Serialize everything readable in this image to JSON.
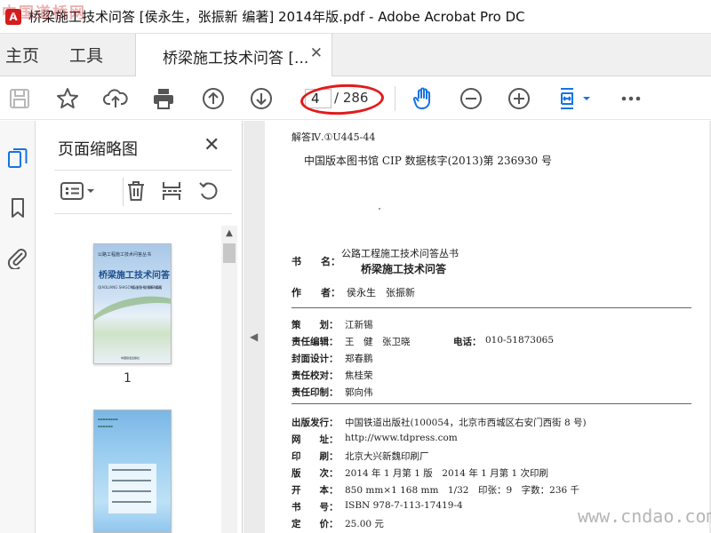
{
  "window": {
    "title": "桥梁施工技术问答 [侯永生，张振新 编著] 2014年版.pdf - Adobe Acrobat Pro DC",
    "watermark_top": "中国道桥网",
    "app_logo_glyph": "A"
  },
  "tabs": {
    "home": "主页",
    "tools": "工具",
    "document": "桥梁施工技术问答 [...",
    "close_glyph": "✕"
  },
  "toolbar": {
    "icons": [
      "save-icon",
      "bookmark-star-icon",
      "upload-cloud-icon",
      "print-icon",
      "previous-page-icon",
      "next-page-icon",
      "hand-tool-icon",
      "zoom-out-icon",
      "zoom-in-icon",
      "fit-page-icon",
      "more-icon"
    ],
    "current_page": "4",
    "total_pages": "/ 286",
    "accent": "#1473e6",
    "highlight_color": "#e21b1b"
  },
  "thumbnail_panel": {
    "title": "页面缩略图",
    "close_glyph": "✕",
    "thumbnails": [
      {
        "series": "公路工程施工技术问答丛书",
        "title": "桥梁施工技术问答",
        "pinyin": "QIAOLIANG SHIGONG JISHU WENDA",
        "authors": "侯永生 张振新 编著",
        "publisher": "中国铁道出版社",
        "label": "1"
      },
      {
        "label": ""
      }
    ]
  },
  "document": {
    "cip_line1": "解答Ⅳ.①U445-44",
    "cip_line2": "中国版本图书馆 CIP 数据核字(2013)第 236930 号",
    "book_label": "书　　名：",
    "book_series": "公路工程施工技术问答丛书",
    "book_title": "桥梁施工技术问答",
    "author_label": "作　　者：",
    "author_value": "侯永生　张振新",
    "credits": [
      {
        "label": "策　　划：",
        "value": "江新锡"
      },
      {
        "label": "责任编辑：",
        "value": "王　健　张卫晓"
      },
      {
        "label": "封面设计：",
        "value": "郑春鹏"
      },
      {
        "label": "责任校对：",
        "value": "焦桂荣"
      },
      {
        "label": "责任印制：",
        "value": "郭向伟"
      }
    ],
    "phone_label": "电话：",
    "phone_value": "010-51873065",
    "pub_info": [
      {
        "label": "出版发行：",
        "value": "中国铁道出版社(100054，北京市西城区右安门西街 8 号)"
      },
      {
        "label": "网　　址：",
        "value": "http://www.tdpress.com"
      },
      {
        "label": "印　　刷：",
        "value": "北京大兴新魏印刷厂"
      },
      {
        "label": "版　　次：",
        "value": "2014 年 1 月第 1 版　2014 年 1 月第 1 次印刷"
      },
      {
        "label": "开　　本：",
        "value": "850 mm×1 168 mm　1/32　印张：9　字数：236 千"
      },
      {
        "label": "书　　号：",
        "value": "ISBN 978-7-113-17419-4"
      },
      {
        "label": "定　　价：",
        "value": "25.00 元"
      }
    ]
  },
  "watermark_bottom": "www.cndao.com"
}
